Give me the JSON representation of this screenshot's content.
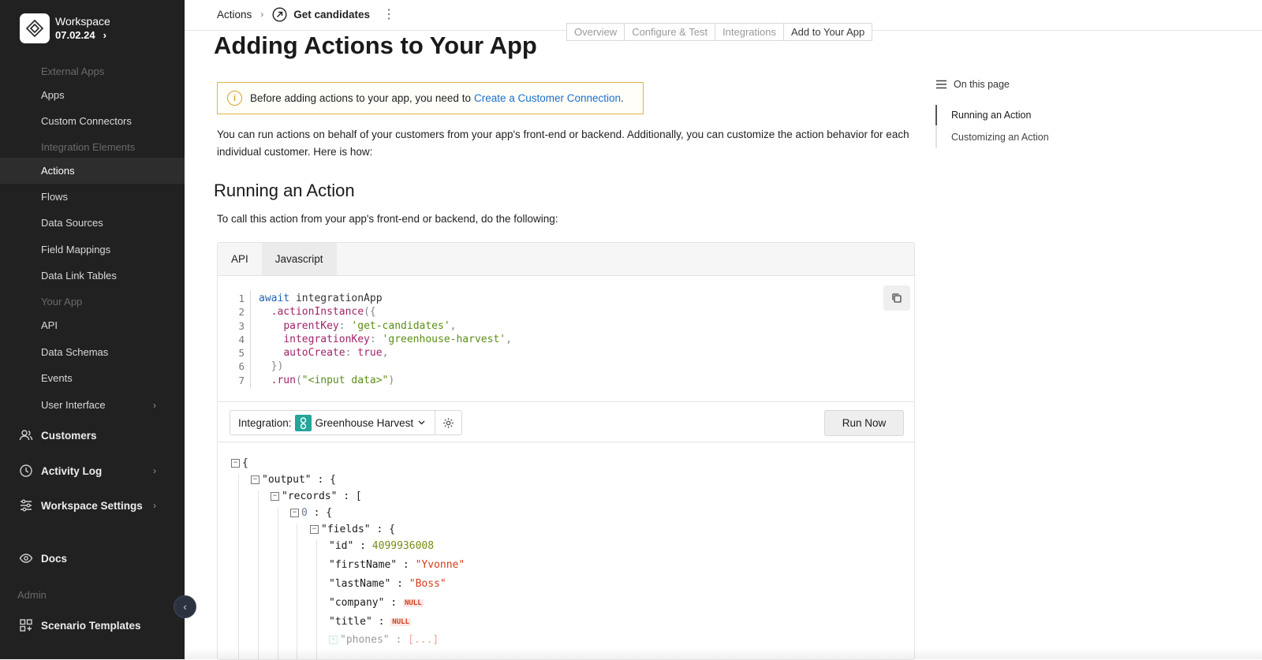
{
  "sidebar": {
    "workspace_name": "Workspace",
    "workspace_version": "07.02.24",
    "sections": {
      "external_apps": "External Apps",
      "integration_elements": "Integration Elements",
      "your_app": "Your App",
      "admin": "Admin"
    },
    "items": {
      "apps": "Apps",
      "custom_connectors": "Custom Connectors",
      "actions": "Actions",
      "flows": "Flows",
      "data_sources": "Data Sources",
      "field_mappings": "Field Mappings",
      "data_link_tables": "Data Link Tables",
      "api": "API",
      "data_schemas": "Data Schemas",
      "events": "Events",
      "user_interface": "User Interface"
    },
    "main": {
      "customers": "Customers",
      "activity_log": "Activity Log",
      "workspace_settings": "Workspace Settings",
      "docs": "Docs",
      "scenario_templates": "Scenario Templates"
    }
  },
  "topbar": {
    "breadcrumb_root": "Actions",
    "breadcrumb_current": "Get candidates",
    "tabs": [
      "Overview",
      "Configure & Test",
      "Integrations",
      "Add to Your App"
    ]
  },
  "content": {
    "title": "Adding Actions to Your App",
    "notice_text": "Before adding actions to your app, you need to",
    "notice_link": "Create a Customer Connection",
    "notice_end": ".",
    "intro": "You can run actions on behalf of your customers from your app's front-end or backend. Additionally, you can customize the action behavior for each individual customer. Here is how:",
    "section_title": "Running an Action",
    "section_intro": "To call this action from your app's front-end or backend, do the following:"
  },
  "panel": {
    "tabs": [
      "API",
      "Javascript"
    ],
    "code_line_numbers": [
      "1",
      "2",
      "3",
      "4",
      "5",
      "6",
      "7"
    ],
    "code": {
      "l1_kw": "await",
      "l1_rest": " integrationApp",
      "l2_method": ".actionInstance",
      "l2_paren": "({",
      "l3_key": "parentKey",
      "l3_val": "'get-candidates'",
      "l4_key": "integrationKey",
      "l4_val": "'greenhouse-harvest'",
      "l5_key": "autoCreate",
      "l5_val": "true",
      "l6": "})",
      "l7_method": ".run",
      "l7_arg": "\"<input data>\""
    },
    "integration_label": "Integration:",
    "integration_name": "Greenhouse Harvest",
    "run_label": "Run Now"
  },
  "json_output": {
    "output_key": "\"output\"",
    "records_key": "\"records\"",
    "index_key": "0",
    "fields_key": "\"fields\"",
    "id_key": "\"id\"",
    "id_val": "4099936008",
    "first_key": "\"firstName\"",
    "first_val": "\"Yvonne\"",
    "last_key": "\"lastName\"",
    "last_val": "\"Boss\"",
    "company_key": "\"company\"",
    "title_key": "\"title\"",
    "null_label": "NULL",
    "phones_key": "\"phones\"",
    "phones_val": "[...]"
  },
  "toc": {
    "header": "On this page",
    "items": [
      "Running an Action",
      "Customizing an Action"
    ]
  },
  "colors": {
    "sidebar_bg": "#212121",
    "link": "#1c6fd1",
    "notice_border": "#e2b53e",
    "greenhouse": "#24a69a"
  }
}
